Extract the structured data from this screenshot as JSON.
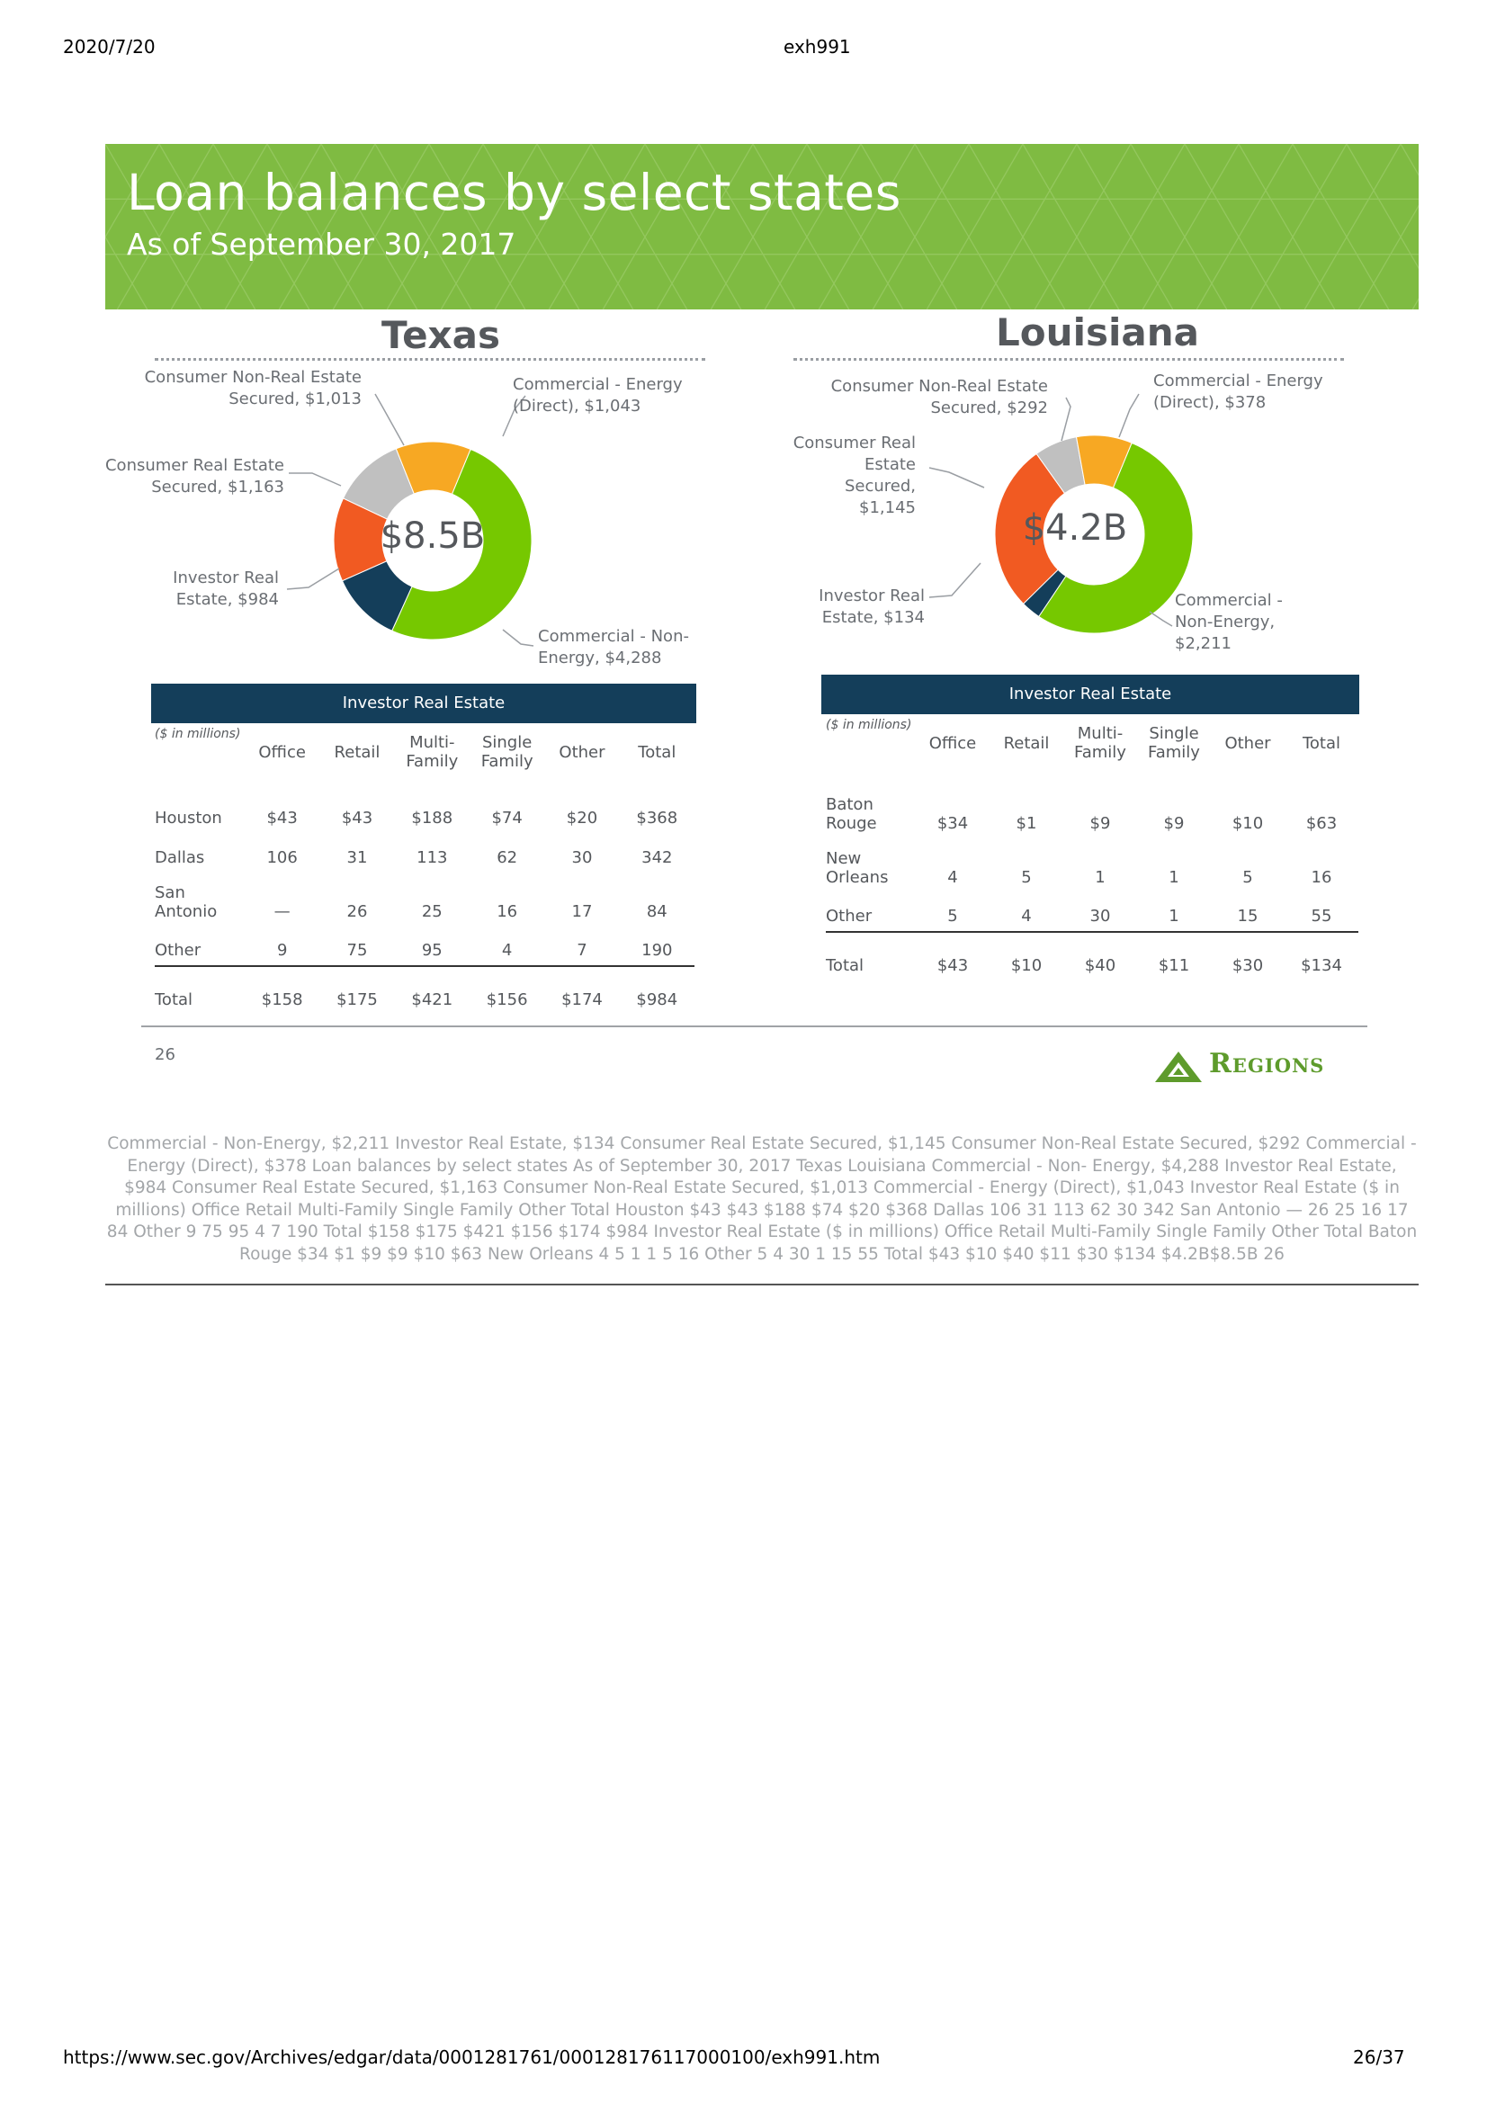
{
  "print_header": {
    "date": "2020/7/20",
    "doc": "exh991"
  },
  "print_footer": {
    "url": "https://www.sec.gov/Archives/edgar/data/0001281761/000128176117000100/exh991.htm",
    "page": "26/37"
  },
  "banner": {
    "title": "Loan balances by select states",
    "subtitle": "As of September 30, 2017",
    "color": "#7fbb42"
  },
  "colors": {
    "commercial_non_energy": "#76c800",
    "commercial_energy": "#f7a823",
    "consumer_non_real_estate": "#c0c0c0",
    "consumer_real_estate": "#f15a22",
    "investor_real_estate": "#143e5a"
  },
  "texas": {
    "title": "Texas",
    "center_label": "$8.5B",
    "labels": {
      "consumer_non_re": [
        "Consumer Non-Real Estate",
        "Secured, $1,013"
      ],
      "commercial_energy": [
        "Commercial - Energy",
        "(Direct), $1,043"
      ],
      "consumer_re": [
        "Consumer Real Estate",
        "Secured, $1,163"
      ],
      "investor_re": [
        "Investor Real",
        "Estate, $984"
      ],
      "commercial_non_energy": [
        "Commercial - Non-",
        "Energy, $4,288"
      ]
    },
    "table": {
      "title": "Investor Real Estate",
      "units": "($ in millions)",
      "headers": [
        "Office",
        "Retail",
        "Multi-Family",
        "Single Family",
        "Other",
        "Total"
      ],
      "header_lines": [
        [
          "Office"
        ],
        [
          "Retail"
        ],
        [
          "Multi-",
          "Family"
        ],
        [
          "Single",
          "Family"
        ],
        [
          "Other"
        ],
        [
          "Total"
        ]
      ],
      "rows": [
        {
          "label": [
            "Houston"
          ],
          "cells": [
            "$43",
            "$43",
            "$188",
            "$74",
            "$20",
            "$368"
          ]
        },
        {
          "label": [
            "Dallas"
          ],
          "cells": [
            "106",
            "31",
            "113",
            "62",
            "30",
            "342"
          ]
        },
        {
          "label": [
            "San",
            "Antonio"
          ],
          "cells": [
            "—",
            "26",
            "25",
            "16",
            "17",
            "84"
          ]
        },
        {
          "label": [
            "Other"
          ],
          "cells": [
            "9",
            "75",
            "95",
            "4",
            "7",
            "190"
          ]
        }
      ],
      "total": {
        "label": [
          "Total"
        ],
        "cells": [
          "$158",
          "$175",
          "$421",
          "$156",
          "$174",
          "$984"
        ]
      }
    }
  },
  "louisiana": {
    "title": "Louisiana",
    "center_label": "$4.2B",
    "labels": {
      "consumer_non_re": [
        "Consumer Non-Real Estate",
        "Secured, $292"
      ],
      "commercial_energy": [
        "Commercial - Energy",
        "(Direct), $378"
      ],
      "consumer_re": [
        "Consumer Real",
        "Estate Secured,",
        "$1,145"
      ],
      "investor_re": [
        "Investor Real",
        "Estate, $134"
      ],
      "commercial_non_energy": [
        "Commercial -",
        "Non-Energy,",
        "$2,211"
      ]
    },
    "table": {
      "title": "Investor Real Estate",
      "units": "($ in millions)",
      "headers": [
        "Office",
        "Retail",
        "Multi-Family",
        "Single Family",
        "Other",
        "Total"
      ],
      "header_lines": [
        [
          "Office"
        ],
        [
          "Retail"
        ],
        [
          "Multi-",
          "Family"
        ],
        [
          "Single",
          "Family"
        ],
        [
          "Other"
        ],
        [
          "Total"
        ]
      ],
      "rows": [
        {
          "label": [
            "Baton",
            "Rouge"
          ],
          "cells": [
            "$34",
            "$1",
            "$9",
            "$9",
            "$10",
            "$63"
          ]
        },
        {
          "label": [
            "New",
            "Orleans"
          ],
          "cells": [
            "4",
            "5",
            "1",
            "1",
            "5",
            "16"
          ]
        },
        {
          "label": [
            "Other"
          ],
          "cells": [
            "5",
            "4",
            "30",
            "1",
            "15",
            "55"
          ]
        }
      ],
      "total": {
        "label": [
          "Total"
        ],
        "cells": [
          "$43",
          "$10",
          "$40",
          "$11",
          "$30",
          "$134"
        ]
      }
    }
  },
  "chart_data": [
    {
      "type": "pie",
      "title": "Texas",
      "center_label": "$8.5B",
      "categories": [
        "Commercial - Non-Energy",
        "Investor Real Estate",
        "Consumer Real Estate Secured",
        "Consumer Non-Real Estate Secured",
        "Commercial - Energy (Direct)"
      ],
      "values": [
        4288,
        984,
        1163,
        1013,
        1043
      ]
    },
    {
      "type": "pie",
      "title": "Louisiana",
      "center_label": "$4.2B",
      "categories": [
        "Commercial - Non-Energy",
        "Investor Real Estate",
        "Consumer Real Estate Secured",
        "Consumer Non-Real Estate Secured",
        "Commercial - Energy (Direct)"
      ],
      "values": [
        2211,
        134,
        1145,
        292,
        378
      ]
    }
  ],
  "slide_footer": {
    "page_number": "26",
    "brand": "Regions"
  },
  "alt_text": "Commercial - Non-Energy, $2,211 Investor Real Estate, $134 Consumer Real Estate Secured, $1,145 Consumer Non-Real Estate Secured, $292 Commercial - Energy (Direct), $378 Loan balances by select states As of September 30, 2017 Texas Louisiana Commercial - Non- Energy, $4,288 Investor Real Estate, $984 Consumer Real Estate Secured, $1,163 Consumer Non-Real Estate Secured, $1,013 Commercial - Energy (Direct), $1,043 Investor Real Estate ($ in millions) Office Retail Multi-Family Single Family Other Total Houston $43 $43 $188 $74 $20 $368 Dallas 106 31 113 62 30 342 San Antonio — 26 25 16 17 84 Other 9 75 95 4 7 190 Total $158 $175 $421 $156 $174 $984 Investor Real Estate ($ in millions) Office Retail Multi-Family Single Family Other Total Baton Rouge $34 $1 $9 $9 $10 $63 New Orleans 4 5 1 1 5 16 Other 5 4 30 1 15 55 Total $43 $10 $40 $11 $30 $134 $4.2B$8.5B 26"
}
